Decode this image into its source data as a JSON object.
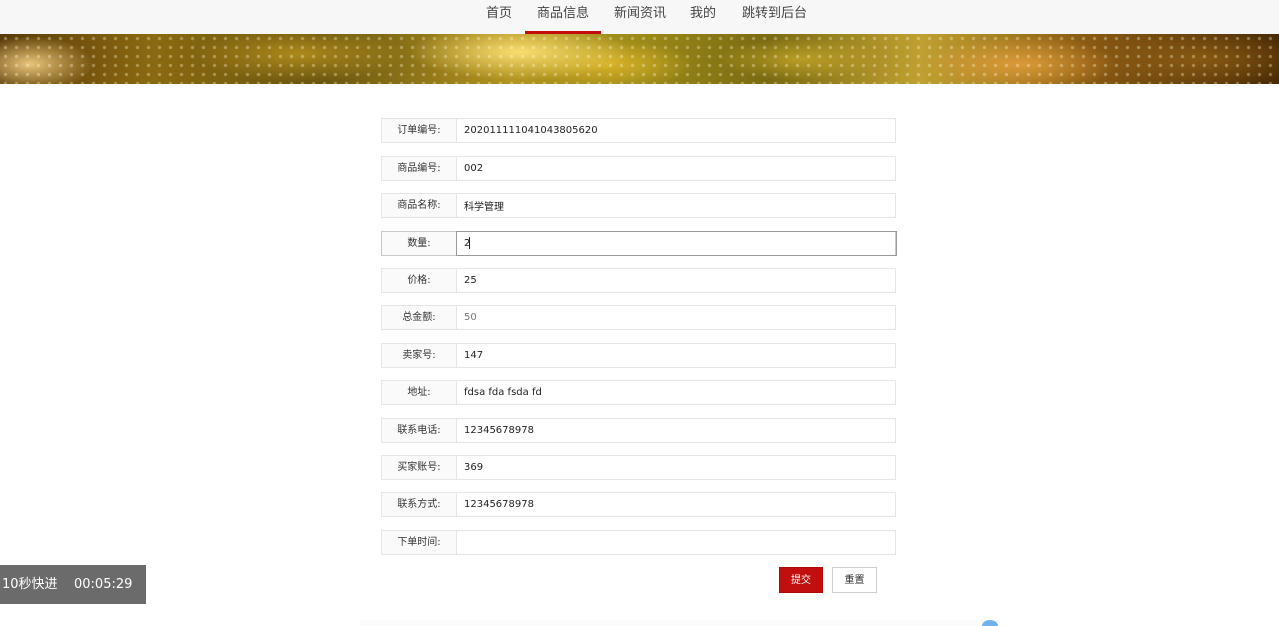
{
  "nav": {
    "items": [
      {
        "label": "首页",
        "active": false
      },
      {
        "label": "商品信息",
        "active": true
      },
      {
        "label": "新闻资讯",
        "active": false
      },
      {
        "label": "我的",
        "active": false
      },
      {
        "label": "跳转到后台",
        "active": false
      }
    ]
  },
  "form": {
    "fields": [
      {
        "label": "订单编号:",
        "value": "202011111041043805620"
      },
      {
        "label": "商品编号:",
        "value": "002"
      },
      {
        "label": "商品名称:",
        "value": "科学管理"
      },
      {
        "label": "数量:",
        "value": "2"
      },
      {
        "label": "价格:",
        "value": "25"
      },
      {
        "label": "总金额:",
        "value": "50"
      },
      {
        "label": "卖家号:",
        "value": "147"
      },
      {
        "label": "地址:",
        "value": "fdsa fda fsda fd"
      },
      {
        "label": "联系电话:",
        "value": "12345678978"
      },
      {
        "label": "买家账号:",
        "value": "369"
      },
      {
        "label": "联系方式:",
        "value": "12345678978"
      },
      {
        "label": "下单时间:",
        "value": ""
      }
    ],
    "submit_label": "提交",
    "reset_label": "重置"
  },
  "overlay": {
    "fast_forward": "10秒快进",
    "time": "00:05:29"
  },
  "colors": {
    "accent": "#c10f0f",
    "nav_bg": "#f7f7f7"
  }
}
